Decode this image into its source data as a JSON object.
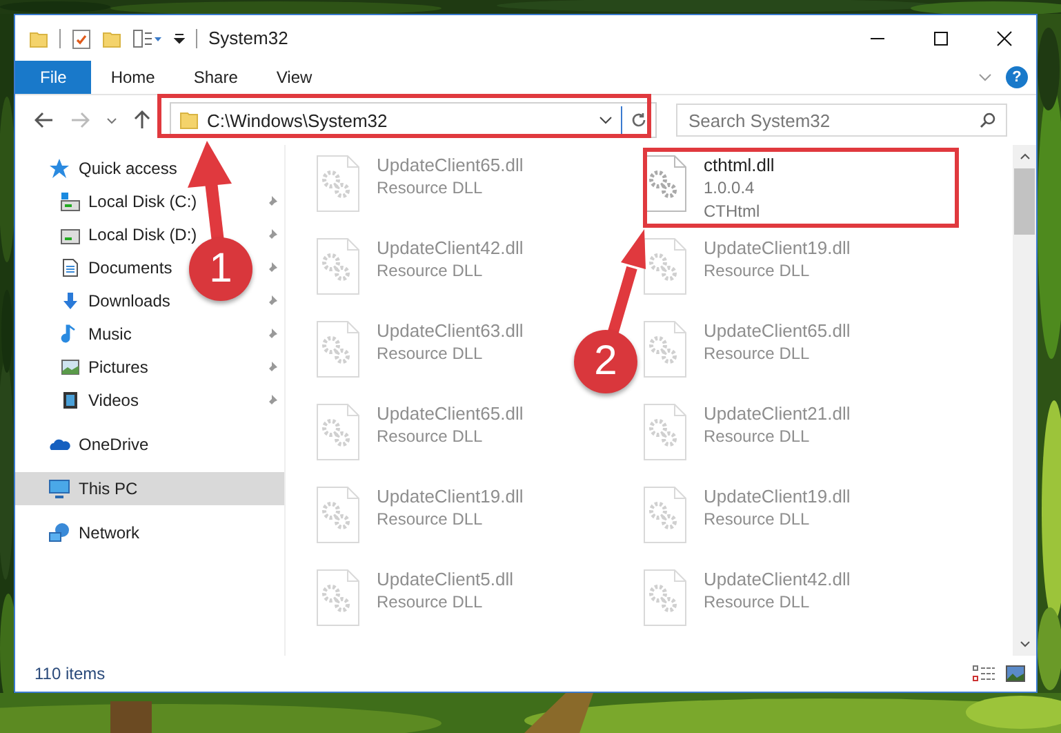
{
  "window": {
    "title": "System32"
  },
  "ribbon_tabs": [
    {
      "label": "File",
      "selected": true
    },
    {
      "label": "Home",
      "selected": false
    },
    {
      "label": "Share",
      "selected": false
    },
    {
      "label": "View",
      "selected": false
    }
  ],
  "help": "?",
  "address": {
    "path": "C:\\Windows\\System32"
  },
  "search": {
    "placeholder": "Search System32"
  },
  "sidebar": {
    "items": [
      {
        "label": "Quick access",
        "selected": false,
        "children": [
          {
            "label": "Local Disk (C:)",
            "pinned": true
          },
          {
            "label": "Local Disk (D:)",
            "pinned": true
          },
          {
            "label": "Documents",
            "pinned": true
          },
          {
            "label": "Downloads",
            "pinned": true
          },
          {
            "label": "Music",
            "pinned": true
          },
          {
            "label": "Pictures",
            "pinned": true
          },
          {
            "label": "Videos",
            "pinned": true
          }
        ]
      },
      {
        "label": "OneDrive",
        "selected": false
      },
      {
        "label": "This PC",
        "selected": true
      },
      {
        "label": "Network",
        "selected": false
      }
    ]
  },
  "files": [
    {
      "name": "UpdateClient65.dll",
      "details": [
        "Resource DLL"
      ],
      "dimmed": true
    },
    {
      "name": "cthtml.dll",
      "details": [
        "1.0.0.4",
        "CTHtml"
      ],
      "dimmed": false
    },
    {
      "name": "UpdateClient42.dll",
      "details": [
        "Resource DLL"
      ],
      "dimmed": true
    },
    {
      "name": "UpdateClient19.dll",
      "details": [
        "Resource DLL"
      ],
      "dimmed": true
    },
    {
      "name": "UpdateClient63.dll",
      "details": [
        "Resource DLL"
      ],
      "dimmed": true
    },
    {
      "name": "UpdateClient65.dll",
      "details": [
        "Resource DLL"
      ],
      "dimmed": true
    },
    {
      "name": "UpdateClient65.dll",
      "details": [
        "Resource DLL"
      ],
      "dimmed": true
    },
    {
      "name": "UpdateClient21.dll",
      "details": [
        "Resource DLL"
      ],
      "dimmed": true
    },
    {
      "name": "UpdateClient19.dll",
      "details": [
        "Resource DLL"
      ],
      "dimmed": true
    },
    {
      "name": "UpdateClient19.dll",
      "details": [
        "Resource DLL"
      ],
      "dimmed": true
    },
    {
      "name": "UpdateClient5.dll",
      "details": [
        "Resource DLL"
      ],
      "dimmed": true
    },
    {
      "name": "UpdateClient42.dll",
      "details": [
        "Resource DLL"
      ],
      "dimmed": true
    }
  ],
  "status_bar": {
    "items": "110 items"
  },
  "annotations": [
    {
      "label": "1"
    },
    {
      "label": "2"
    }
  ]
}
